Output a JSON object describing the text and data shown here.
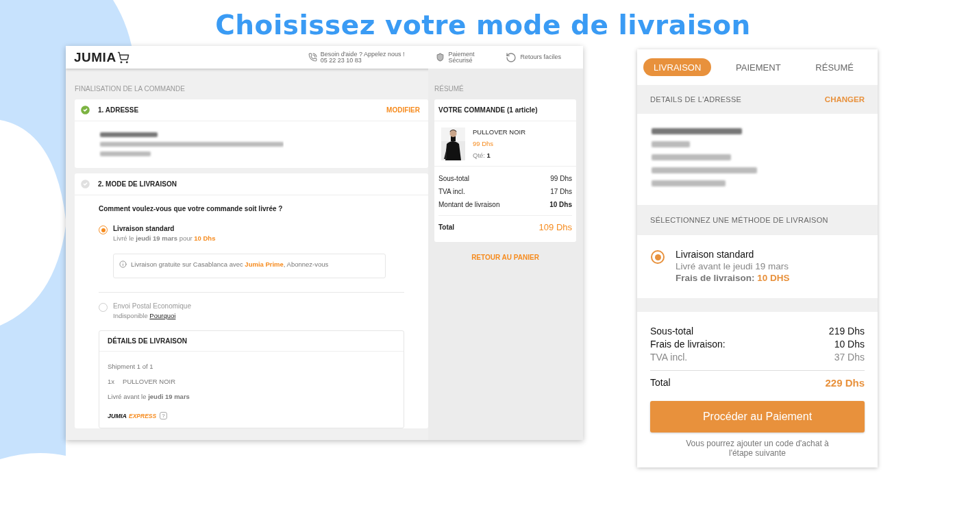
{
  "headline": "Choisissez votre mode de livraison",
  "desktop": {
    "header": {
      "logo": "JUMIA",
      "help": {
        "line1": "Besoin d'aide ? Appelez nous !",
        "line2": "05 22 23 10 83"
      },
      "payment": {
        "line1": "Paiement",
        "line2": "Sécurisé"
      },
      "returns": "Retours faciles"
    },
    "section_label": "FINALISATION DE LA COMMANDE",
    "address_step": {
      "title": "1. ADRESSE",
      "done": true,
      "action": "MODIFIER"
    },
    "delivery_step": {
      "title": "2. MODE DE LIVRAISON",
      "done": false,
      "question": "Comment voulez-vous que votre commande soit livrée ?",
      "options": [
        {
          "title": "Livraison standard",
          "selected": true,
          "disabled": false,
          "detail": "Livré le **jeudi 19 mars** pour",
          "price": "10 Dhs",
          "notice": "Livraison gratuite sur Casablanca avec",
          "notice_link": "Jumia Prime",
          "notice_tail": ", Abonnez-vous"
        },
        {
          "title": "Envoi Postal Economique",
          "selected": false,
          "disabled": true,
          "detail": "Indisponible",
          "link": "Pourquoi"
        }
      ],
      "details": {
        "title": "DÉTAILS DE LIVRAISON",
        "shipment": "Shipment 1 of 1",
        "quantity": "1x",
        "product": "PULLOVER NOIR",
        "eta": "Livré avant le **jeudi 19 mars**",
        "carrier": "JUMIA",
        "carrier_tag": "EXPRESS",
        "help": "?"
      }
    },
    "summary_label": "RÉSUMÉ",
    "order": {
      "title": "VOTRE COMMANDE (1 article)",
      "product": {
        "name": "PULLOVER NOIR",
        "price": "99 Dhs",
        "qty": "Qté: **1**"
      },
      "lines": [
        {
          "label": "Sous-total",
          "value": "99 Dhs",
          "bold": false
        },
        {
          "label": "TVA incl.",
          "value": "17 Dhs",
          "bold": false
        },
        {
          "label": "Montant de livraison",
          "value": "10 Dhs",
          "bold": true
        }
      ],
      "total": {
        "label": "Total",
        "value": "109 Dhs"
      }
    },
    "back_link": "RETOUR AU PANIER"
  },
  "mobile": {
    "tabs": [
      {
        "label": "LIVRAISON",
        "selected": true
      },
      {
        "label": "PAIEMENT",
        "selected": false
      },
      {
        "label": "RÉSUMÉ",
        "selected": false
      }
    ],
    "address_header": "DETAILS DE L'ADRESSE",
    "address_action": "CHANGER",
    "method_header": "SÉLECTIONNEZ UNE MÉTHODE DE LIVRAISON",
    "option": {
      "title": "Livraison standard",
      "selected": true,
      "eta": "Livré avant le jeudi 19 mars",
      "fee_label": "Frais de livraison:",
      "fee_value": "10 DHS"
    },
    "lines": [
      {
        "label": "Sous-total",
        "value": "219 Dhs",
        "muted": false
      },
      {
        "label": "Frais de livraison:",
        "value": "10 Dhs",
        "muted": false
      },
      {
        "label": "TVA incl.",
        "value": "37 Dhs",
        "muted": true
      }
    ],
    "total": {
      "label": "Total",
      "value": "229 Dhs"
    },
    "button": "Procéder au Paiement",
    "note": "Vous pourrez ajouter un code d'achat à l'étape suivante"
  }
}
